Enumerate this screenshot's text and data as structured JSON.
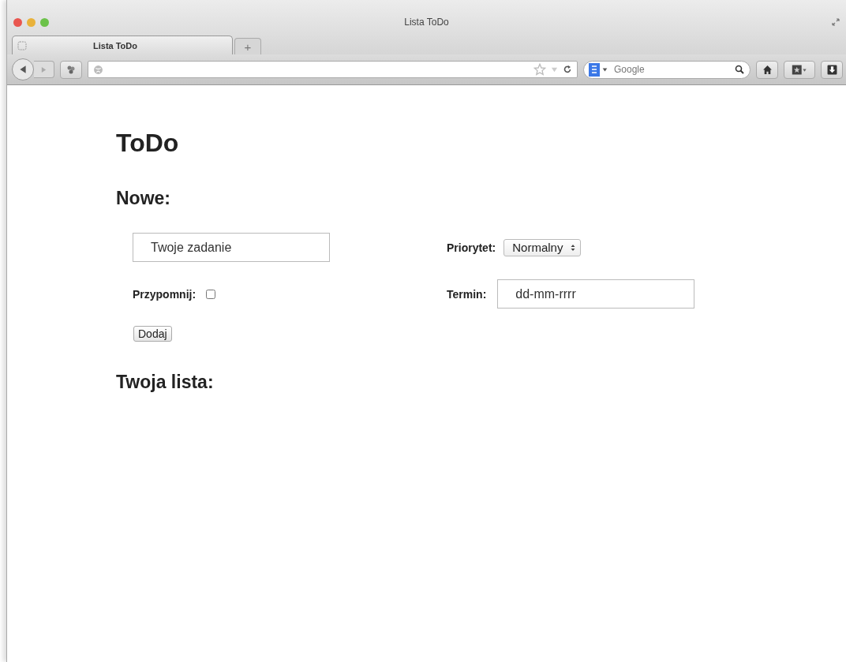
{
  "window": {
    "title": "Lista ToDo"
  },
  "tabs": [
    {
      "label": "Lista ToDo",
      "selected": true
    }
  ],
  "new_tab_button": "+",
  "search": {
    "engine_placeholder": "Google"
  },
  "page": {
    "title": "ToDo",
    "new_heading": "Nowe:",
    "task_field": {
      "placeholder": "Twoje zadanie"
    },
    "priority": {
      "label": "Priorytet:",
      "value": "Normalny"
    },
    "remind": {
      "label": "Przypomnij:",
      "checked": false
    },
    "deadline": {
      "label": "Termin:",
      "placeholder": "dd-mm-rrrr"
    },
    "add_button": "Dodaj",
    "list_heading": "Twoja lista:"
  }
}
